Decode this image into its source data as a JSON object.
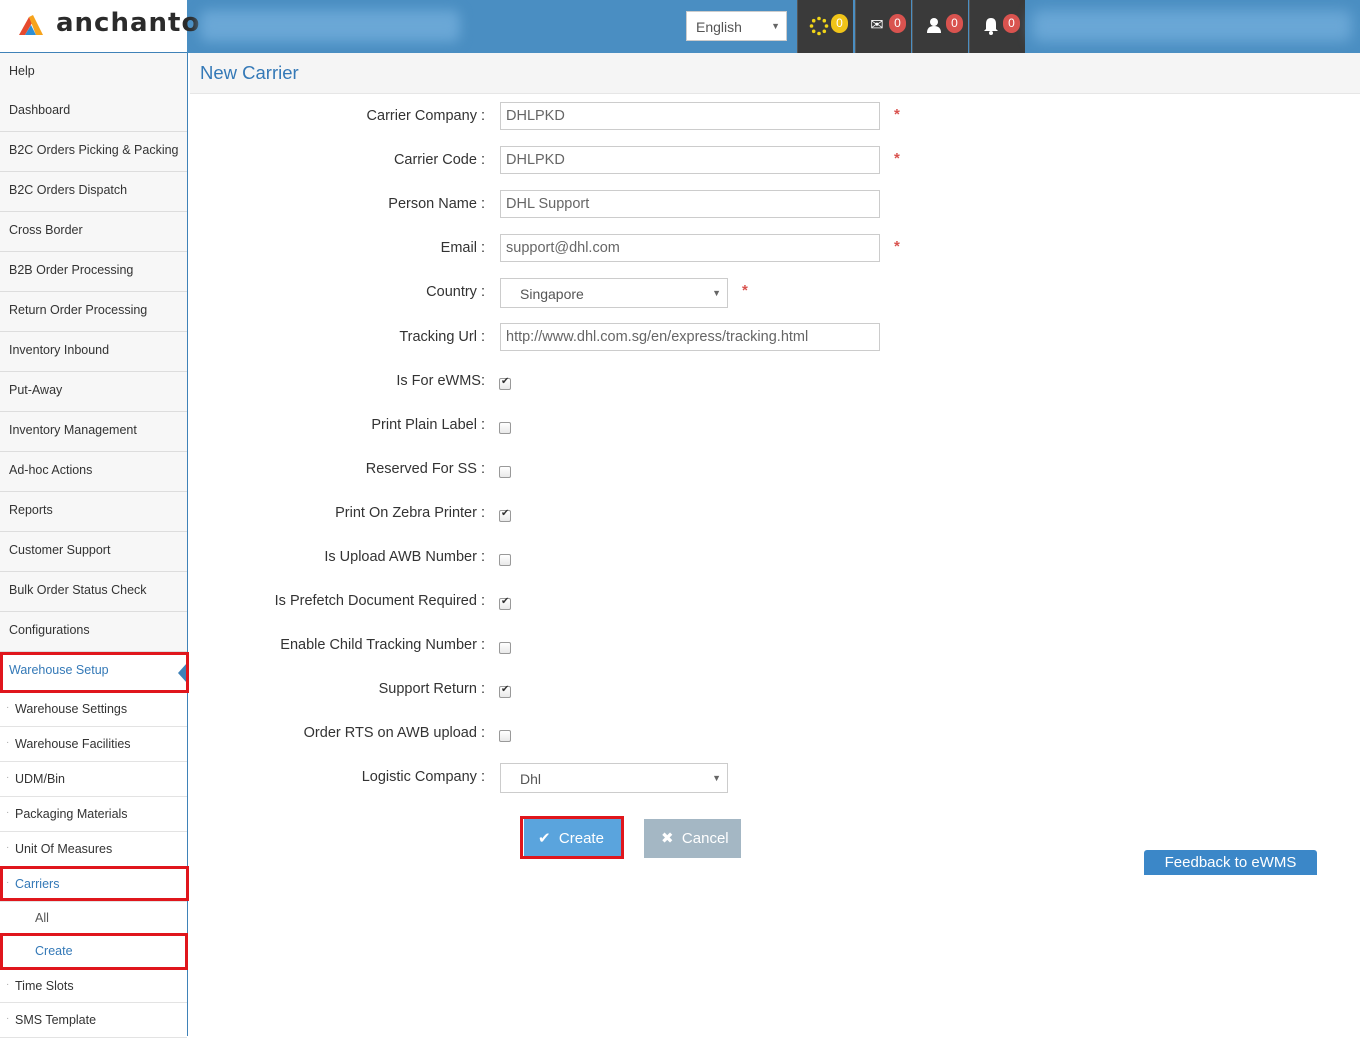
{
  "header": {
    "brand": "anchanto",
    "language": "English",
    "badges": {
      "loader": "0",
      "messages": "0",
      "users": "0",
      "notifications": "0"
    }
  },
  "sidebar": {
    "items": [
      "Help",
      "Dashboard",
      "B2C Orders Picking & Packing",
      "B2C Orders Dispatch",
      "Cross Border",
      "B2B Order Processing",
      "Return Order Processing",
      "Inventory Inbound",
      "Put-Away",
      "Inventory Management",
      "Ad-hoc Actions",
      "Reports",
      "Customer Support",
      "Bulk Order Status Check",
      "Configurations",
      "Warehouse Setup"
    ],
    "subitems": [
      "Warehouse Settings",
      "Warehouse Facilities",
      "UDM/Bin",
      "Packaging Materials",
      "Unit Of Measures",
      "Carriers"
    ],
    "carriers_children": [
      "All",
      "Create"
    ],
    "more_subitems": [
      "Time Slots",
      "SMS Template"
    ]
  },
  "page": {
    "title": "New Carrier"
  },
  "form": {
    "carrier_company": {
      "label": "Carrier Company :",
      "value": "DHLPKD"
    },
    "carrier_code": {
      "label": "Carrier Code :",
      "value": "DHLPKD"
    },
    "person_name": {
      "label": "Person Name :",
      "value": "DHL Support"
    },
    "email": {
      "label": "Email :",
      "value": "support@dhl.com"
    },
    "country": {
      "label": "Country :",
      "value": "Singapore"
    },
    "tracking_url": {
      "label": "Tracking Url :",
      "value": "http://www.dhl.com.sg/en/express/tracking.html"
    },
    "is_for_ewms": {
      "label": "Is For eWMS:",
      "checked": true
    },
    "print_plain_label": {
      "label": "Print Plain Label :",
      "checked": false
    },
    "reserved_for_ss": {
      "label": "Reserved For SS :",
      "checked": false
    },
    "print_on_zebra": {
      "label": "Print On Zebra Printer :",
      "checked": true
    },
    "is_upload_awb": {
      "label": "Is Upload AWB Number :",
      "checked": false
    },
    "prefetch_doc": {
      "label": "Is Prefetch Document Required :",
      "checked": true
    },
    "child_tracking": {
      "label": "Enable Child Tracking Number :",
      "checked": false
    },
    "support_return": {
      "label": "Support Return :",
      "checked": true
    },
    "order_rts": {
      "label": "Order RTS on AWB upload :",
      "checked": false
    },
    "logistic_company": {
      "label": "Logistic Company :",
      "value": "Dhl"
    },
    "required_mark": "*"
  },
  "actions": {
    "create": "Create",
    "cancel": "Cancel"
  },
  "feedback": "Feedback to eWMS",
  "colors": {
    "header": "#4a8ec2",
    "accent": "#3479b7",
    "highlight": "#e0161c"
  }
}
